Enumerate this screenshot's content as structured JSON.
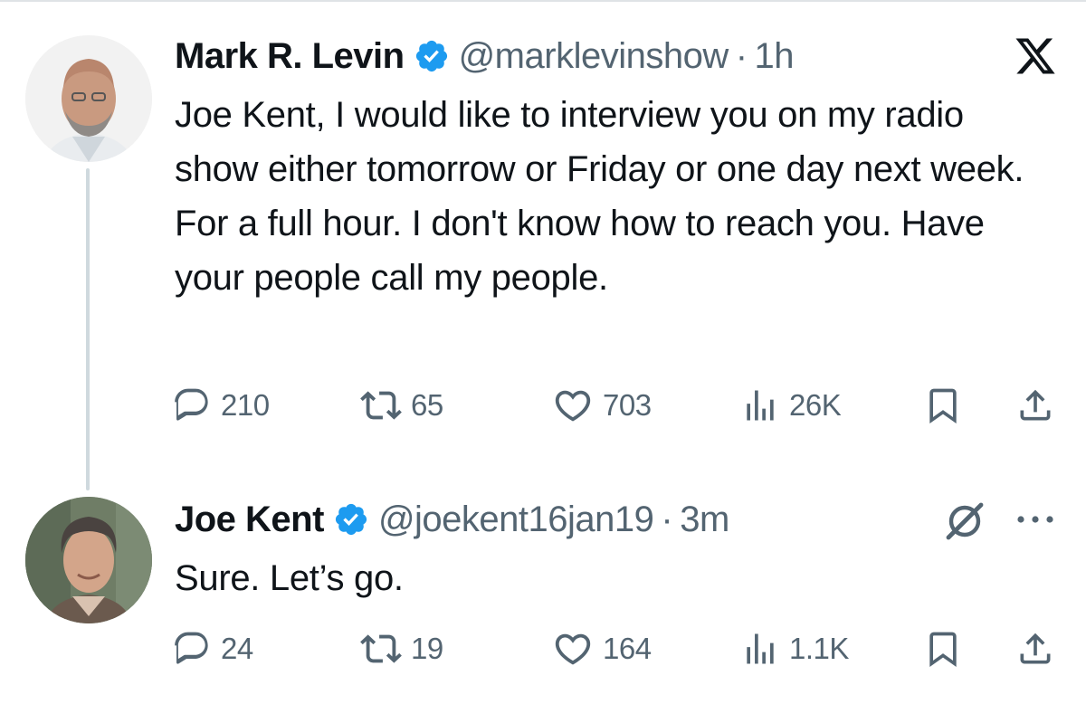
{
  "tweets": [
    {
      "name": "Mark R. Levin",
      "handle": "@marklevinshow",
      "separator": "·",
      "time": "1h",
      "text": "Joe Kent, I would like to interview you on my radio show either tomorrow or Friday or one day next week.  For a full hour.  I don't know how to reach you.  Have your people call my people.",
      "replies": "210",
      "reposts": "65",
      "likes": "703",
      "views": "26K"
    },
    {
      "name": "Joe Kent",
      "handle": "@joekent16jan19",
      "separator": "·",
      "time": "3m",
      "text": "Sure. Let’s go.",
      "replies": "24",
      "reposts": "19",
      "likes": "164",
      "views": "1.1K"
    }
  ],
  "icons": {
    "verified": "verified-badge-icon",
    "platform": "x-logo-icon",
    "grok": "grok-icon",
    "more": "more-icon",
    "reply": "reply-icon",
    "repost": "repost-icon",
    "like": "heart-icon",
    "views": "views-icon",
    "bookmark": "bookmark-icon",
    "share": "share-icon"
  },
  "colors": {
    "text": "#0f1419",
    "secondary": "#536471",
    "verified": "#1d9bf0",
    "thread_line": "#cfd9de"
  }
}
